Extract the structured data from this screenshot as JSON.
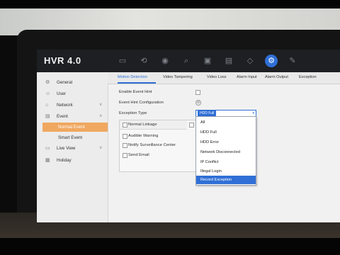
{
  "app": {
    "brand": "HVR 4.0"
  },
  "topbar": {
    "icons": [
      {
        "name": "live-view-icon",
        "glyph": "▭"
      },
      {
        "name": "playback-icon",
        "glyph": "⟲"
      },
      {
        "name": "record-icon",
        "glyph": "◉"
      },
      {
        "name": "search-icon",
        "glyph": "⌕"
      },
      {
        "name": "camera-icon",
        "glyph": "▣"
      },
      {
        "name": "storage-icon",
        "glyph": "▤"
      },
      {
        "name": "network-icon",
        "glyph": "◇"
      },
      {
        "name": "settings-icon",
        "glyph": "⚙"
      },
      {
        "name": "system-icon",
        "glyph": "✎"
      }
    ]
  },
  "sidebar": {
    "items": [
      {
        "label": "General",
        "icon": "gear-icon",
        "glyph": "⚙"
      },
      {
        "label": "User",
        "icon": "user-icon",
        "glyph": "☺"
      },
      {
        "label": "Network",
        "icon": "network-icon",
        "glyph": "⌂",
        "chevron": "∨"
      },
      {
        "label": "Event",
        "icon": "event-icon",
        "glyph": "▤",
        "chevron": "∧"
      },
      {
        "label": "Normal Event",
        "sub": true,
        "selected": true
      },
      {
        "label": "Smart Event",
        "sub": true
      },
      {
        "label": "Live View",
        "icon": "monitor-icon",
        "glyph": "▭",
        "chevron": "∨"
      },
      {
        "label": "Holiday",
        "icon": "calendar-icon",
        "glyph": "▦"
      }
    ]
  },
  "tabs": [
    {
      "label": "Motion Detection",
      "active": true
    },
    {
      "label": "Video Tampering"
    },
    {
      "label": "Video Loss"
    },
    {
      "label": "Alarm Input"
    },
    {
      "label": "Alarm Output"
    },
    {
      "label": "Exception"
    }
  ],
  "form": {
    "enable_event_hint_label": "Enable Event Hint",
    "event_hint_config_label": "Event Hint Configuration",
    "exception_type_label": "Exception Type",
    "exception_type_value": "HDD Full",
    "select_arrow": "▾",
    "linkage": {
      "normal_linkage": "Normal Linkage",
      "audible_warning": "Audible Warning",
      "notify_center": "Notify Surveillance Center",
      "send_email": "Send Email"
    }
  },
  "dropdown": {
    "options": [
      "All",
      "HDD Full",
      "HDD Error",
      "Network Disconnected",
      "IP Conflict",
      "Illegal Login",
      "Record Exception"
    ],
    "highlighted": "Record Exception"
  },
  "colors": {
    "accent": "#2f6fd6",
    "selected_nav": "#f0a860",
    "topbar": "#1d1f22"
  }
}
